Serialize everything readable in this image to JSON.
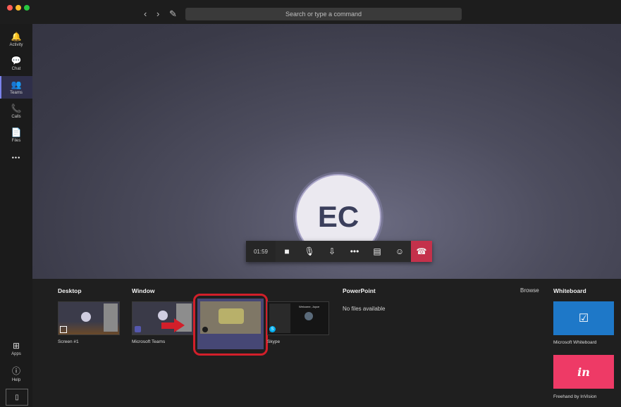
{
  "titlebar": {
    "search_placeholder": "Search or type a command",
    "back": "‹",
    "forward": "›",
    "compose": "✎"
  },
  "rail": {
    "items": [
      {
        "label": "Activity",
        "icon": "🔔"
      },
      {
        "label": "Chat",
        "icon": "💬"
      },
      {
        "label": "Teams",
        "icon": "👥"
      },
      {
        "label": "Calls",
        "icon": "📞"
      },
      {
        "label": "Files",
        "icon": "📄"
      }
    ],
    "more": "•••",
    "apps_label": "Apps",
    "help_label": "Help",
    "active": "Teams"
  },
  "call": {
    "avatar_initials": "EC",
    "timer": "01:59"
  },
  "share": {
    "desktop_title": "Desktop",
    "window_title": "Window",
    "powerpoint_title": "PowerPoint",
    "browse_label": "Browse",
    "whiteboard_title": "Whiteboard",
    "no_files": "No files available",
    "screen_label": "Screen #1",
    "teams_label": "Microsoft Teams",
    "skype_label": "Skype",
    "whiteboard_label": "Microsoft Whiteboard",
    "invision_label": "Freehand by InVision",
    "invision_logo": "in",
    "skype_welcome": "Welcome, Joyce"
  },
  "colors": {
    "accent": "#7b83eb",
    "hangup": "#c4314b",
    "highlight": "#d21f2a",
    "whiteboard": "#1e78c8",
    "invision": "#ee3a66"
  }
}
